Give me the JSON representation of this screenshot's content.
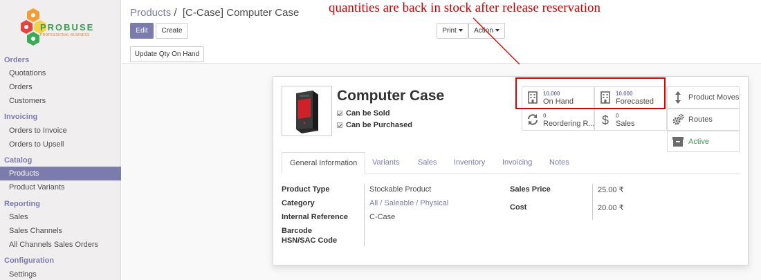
{
  "brand": {
    "name": "PROBUSE",
    "tagline": "PROFESSIONAL BUSINESS"
  },
  "sidebar": {
    "sections": [
      {
        "title": "Orders",
        "items": [
          "Quotations",
          "Orders",
          "Customers"
        ]
      },
      {
        "title": "Invoicing",
        "items": [
          "Orders to Invoice",
          "Orders to Upsell"
        ]
      },
      {
        "title": "Catalog",
        "items": [
          "Products",
          "Product Variants"
        ]
      },
      {
        "title": "Reporting",
        "items": [
          "Sales",
          "Sales Channels",
          "All Channels Sales Orders"
        ]
      },
      {
        "title": "Configuration",
        "items": [
          "Settings"
        ]
      }
    ],
    "active_item": "Products"
  },
  "breadcrumb": {
    "parent": "Products",
    "separator": "/",
    "current": "[C-Case] Computer Case"
  },
  "toolbar": {
    "edit_label": "Edit",
    "create_label": "Create",
    "print_label": "Print",
    "action_label": "Action",
    "update_qty_label": "Update Qty On Hand"
  },
  "annotation": "quantities are back in stock after release reservation",
  "product": {
    "name": "Computer Case",
    "can_be_sold_label": "Can be Sold",
    "can_be_purchased_label": "Can be Purchased"
  },
  "stats": {
    "on_hand": {
      "value": "10.000",
      "label": "On Hand"
    },
    "forecasted": {
      "value": "10.000",
      "label": "Forecasted"
    },
    "product_moves": {
      "label": "Product Moves"
    },
    "reordering": {
      "value": "0",
      "label": "Reordering R..."
    },
    "sales": {
      "value": "0",
      "label": "Sales"
    },
    "routes": {
      "label": "Routes"
    },
    "active": {
      "label": "Active"
    }
  },
  "tabs": [
    "General Information",
    "Variants",
    "Sales",
    "Inventory",
    "Invoicing",
    "Notes"
  ],
  "fields": {
    "product_type": {
      "label": "Product Type",
      "value": "Stockable Product"
    },
    "category": {
      "label": "Category",
      "value": "All / Saleable / Physical"
    },
    "internal_reference": {
      "label": "Internal Reference",
      "value": "C-Case"
    },
    "barcode": {
      "label": "Barcode",
      "value": ""
    },
    "hsn": {
      "label": "HSN/SAC Code",
      "value": ""
    },
    "sales_price": {
      "label": "Sales Price",
      "value": "25.00 ₹"
    },
    "cost": {
      "label": "Cost",
      "value": "20.00 ₹"
    }
  },
  "colors": {
    "accent": "#7c7bad",
    "annotation": "#d40000",
    "active_green": "#3a9c52"
  }
}
